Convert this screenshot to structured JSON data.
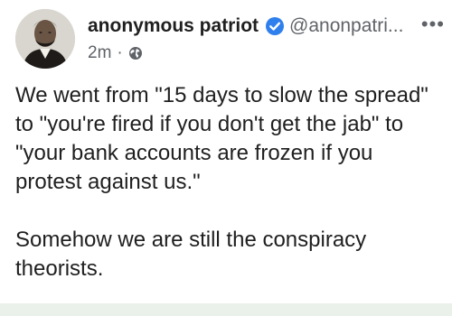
{
  "post": {
    "author": {
      "display_name": "anonymous patriot",
      "handle": "@anonpatri...",
      "avatar_icon": "portrait-avatar",
      "verified_icon": "verified-badge-icon",
      "verified_color": "#2f80ed"
    },
    "meta": {
      "time": "2m",
      "separator": "·",
      "visibility_icon": "globe-icon"
    },
    "more_label": "•••",
    "body": [
      "We went from \"15 days to slow the spread\"\nto \"you're fired if you don't get the jab\" to\n\"your bank accounts are frozen if you\nprotest against us.\"",
      "Somehow we are still the conspiracy\ntheorists."
    ]
  },
  "colors": {
    "background": "#ffffff",
    "text": "#1f1f1f",
    "secondary_text": "#5f6368",
    "bottom_bar": "#eaf0ea"
  }
}
